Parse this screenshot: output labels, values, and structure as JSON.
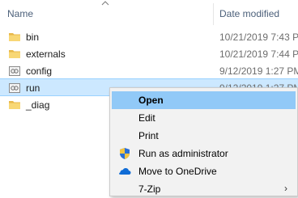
{
  "header": {
    "name_label": "Name",
    "date_label": "Date modified"
  },
  "files": [
    {
      "name": "bin",
      "date": "10/21/2019 7:43 PM",
      "icon": "folder-icon"
    },
    {
      "name": "externals",
      "date": "10/21/2019 7:44 PM",
      "icon": "folder-icon"
    },
    {
      "name": "config",
      "date": "9/12/2019 1:27 PM",
      "icon": "script-file-icon"
    },
    {
      "name": "run",
      "date": "9/12/2019 1:27 PM",
      "icon": "script-file-icon",
      "selected": true
    },
    {
      "name": "_diag",
      "date": "",
      "icon": "folder-icon"
    }
  ],
  "context_menu": {
    "items": [
      {
        "label": "Open",
        "default": true,
        "highlighted": true
      },
      {
        "label": "Edit"
      },
      {
        "label": "Print"
      },
      {
        "label": "Run as administrator",
        "icon": "uac-shield-icon"
      },
      {
        "label": "Move to OneDrive",
        "icon": "onedrive-cloud-icon"
      },
      {
        "label": "7-Zip",
        "submenu": true
      }
    ]
  },
  "colors": {
    "selection": "#cce8ff",
    "menu_highlight": "#91c9f7",
    "menu_background": "#f2f2f2",
    "folder": "#f8d775"
  }
}
